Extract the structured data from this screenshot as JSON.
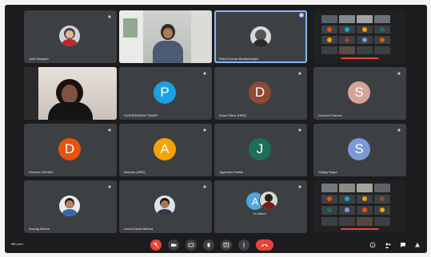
{
  "participants": [
    {
      "name": "Jyoti Mangam"
    },
    {
      "name": ""
    },
    {
      "name": "Rahul Kumar Bhattacharjee"
    },
    {
      "name": ""
    },
    {
      "name": ""
    },
    {
      "name": "FUSHPENDRA TIWARI",
      "initial": "P",
      "color": "#1ba1e2"
    },
    {
      "name": "Grant Office (HRD)",
      "initial": "D",
      "color": "#8d4a34"
    },
    {
      "name": "Director Frances",
      "initial": "S",
      "color": "#d4a596"
    },
    {
      "name": "Director VIDHAN",
      "initial": "D",
      "color": "#e8520f"
    },
    {
      "name": "Mamuni (HRD)",
      "initial": "A",
      "color": "#f4a300"
    },
    {
      "name": "Jagendra Pathak",
      "initial": "J",
      "color": "#1f6e5a"
    },
    {
      "name": "Sanjay Rajan",
      "initial": "S",
      "color": "#7c99d7"
    },
    {
      "name": "Anurag Mishra"
    },
    {
      "name": "Laxmi Kanta Behera"
    },
    {
      "name": "12 others",
      "initial": "A",
      "color": "#4fa4dc"
    },
    {
      "name": ""
    }
  ],
  "footer": {
    "meeting_code": "dffn-ued"
  },
  "colors": {
    "background": "#1c1c1e",
    "tile": "#3c4043",
    "accent": "#8ab4f8",
    "danger": "#ea4335"
  },
  "icons": {
    "controls": [
      "mic-off-icon",
      "camera-off-icon",
      "captions-icon",
      "raise-hand-icon",
      "present-icon",
      "more-options-icon",
      "hangup-icon"
    ],
    "right": [
      "info-icon",
      "people-icon",
      "chat-icon",
      "activities-icon"
    ]
  }
}
